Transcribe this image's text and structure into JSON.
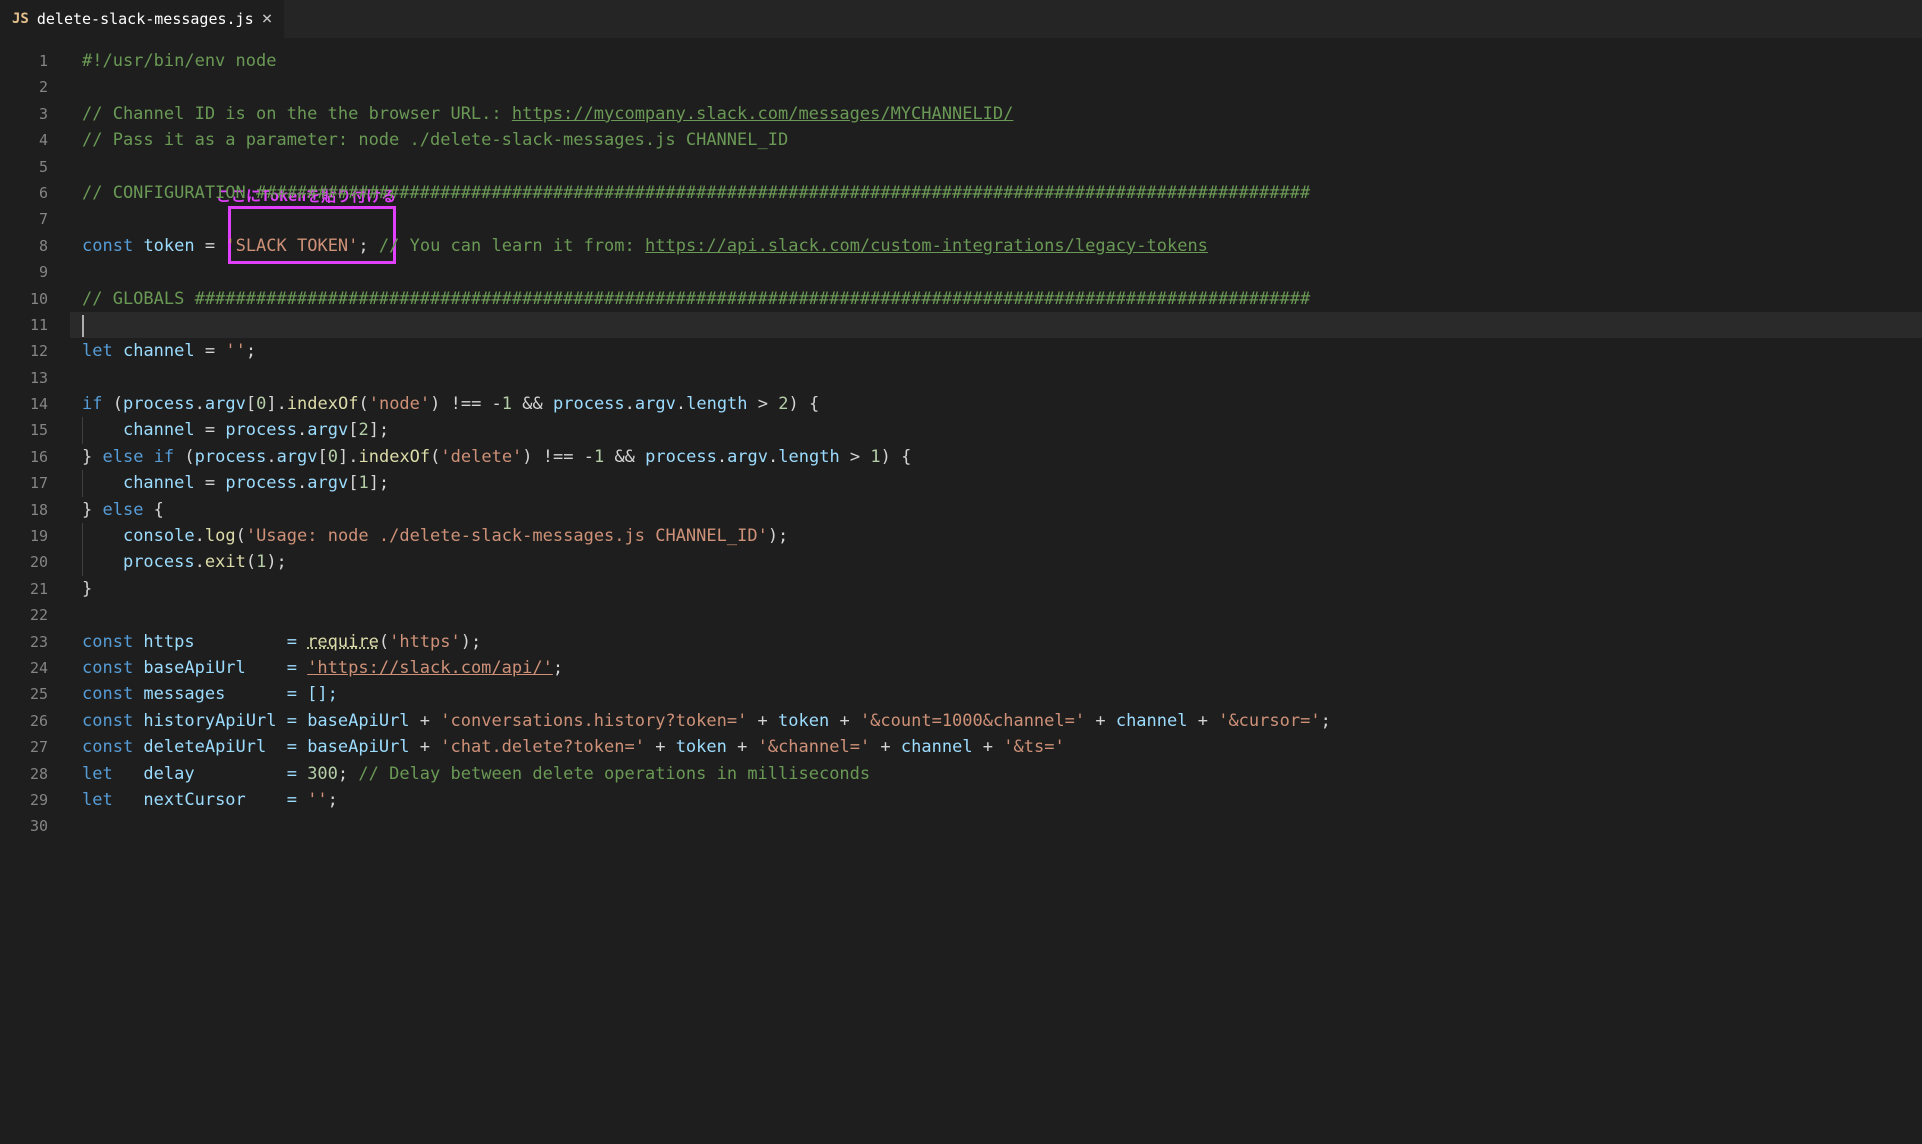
{
  "tab": {
    "icon_text": "JS",
    "title": "delete-slack-messages.js"
  },
  "annotation": {
    "label": "ここにTokenを貼り付ける"
  },
  "lines": [
    {
      "n": 1
    },
    {
      "n": 2
    },
    {
      "n": 3
    },
    {
      "n": 4
    },
    {
      "n": 5
    },
    {
      "n": 6
    },
    {
      "n": 7
    },
    {
      "n": 8
    },
    {
      "n": 9
    },
    {
      "n": 10
    },
    {
      "n": 11
    },
    {
      "n": 12
    },
    {
      "n": 13
    },
    {
      "n": 14
    },
    {
      "n": 15
    },
    {
      "n": 16
    },
    {
      "n": 17
    },
    {
      "n": 18
    },
    {
      "n": 19
    },
    {
      "n": 20
    },
    {
      "n": 21
    },
    {
      "n": 22
    },
    {
      "n": 23
    },
    {
      "n": 24
    },
    {
      "n": 25
    },
    {
      "n": 26
    },
    {
      "n": 27
    },
    {
      "n": 28
    },
    {
      "n": 29
    },
    {
      "n": 30
    }
  ],
  "code": {
    "l1_shebang": "#!/usr/bin/env node",
    "l3_c1": "// Channel ID is on the the browser URL.: ",
    "l3_u": "https://mycompany.slack.com/messages/MYCHANNELID/",
    "l4_c": "// Pass it as a parameter: node ./delete-slack-messages.js CHANNEL_ID",
    "l6_c": "// CONFIGURATION #######################################################################################################",
    "l8_const": "const",
    "l8_token": "token",
    "l8_eq": " = ",
    "l8_str": "'SLACK TOKEN'",
    "l8_semi": ";",
    "l8_c1": " // You can learn it from: ",
    "l8_u": "https://api.slack.com/custom-integrations/legacy-tokens",
    "l10_c": "// GLOBALS #############################################################################################################",
    "l12_let": "let",
    "l12_var": "channel",
    "l12_rest": " = ",
    "l12_str": "''",
    "l12_semi": ";",
    "l14_if": "if",
    "l14_open": " (",
    "l14_proc": "process",
    "l14_dot1": ".",
    "l14_argv": "argv",
    "l14_idx": "[",
    "l14_zero": "0",
    "l14_idx2": "].",
    "l14_indexof": "indexOf",
    "l14_paren": "(",
    "l14_node": "'node'",
    "l14_close1": ") !== -",
    "l14_neg1": "1",
    "l14_and": " && ",
    "l14_proc2": "process",
    "l14_dot2": ".",
    "l14_argv2": "argv",
    "l14_dot3": ".",
    "l14_len": "length",
    "l14_gt": " > ",
    "l14_two": "2",
    "l14_endp": ") {",
    "l15_ind": "    ",
    "l15_chan": "channel",
    "l15_eq": " = ",
    "l15_proc": "process",
    "l15_dot": ".",
    "l15_argv": "argv",
    "l15_br": "[",
    "l15_2": "2",
    "l15_end": "];",
    "l16_cb": "} ",
    "l16_else": "else",
    "l16_sp": " ",
    "l16_if": "if",
    "l16_open": " (",
    "l16_proc": "process",
    "l16_d1": ".",
    "l16_argv": "argv",
    "l16_br": "[",
    "l16_0": "0",
    "l16_br2": "].",
    "l16_io": "indexOf",
    "l16_p": "(",
    "l16_del": "'delete'",
    "l16_cp": ") !== -",
    "l16_1": "1",
    "l16_and": " && ",
    "l16_proc2": "process",
    "l16_d2": ".",
    "l16_argv2": "argv",
    "l16_d3": ".",
    "l16_len": "length",
    "l16_gt": " > ",
    "l16_one": "1",
    "l16_end": ") {",
    "l17_ind": "    ",
    "l17_chan": "channel",
    "l17_eq": " = ",
    "l17_proc": "process",
    "l17_d": ".",
    "l17_argv": "argv",
    "l17_br": "[",
    "l17_1": "1",
    "l17_end": "];",
    "l18_cb": "} ",
    "l18_else": "else",
    "l18_ob": " {",
    "l19_ind": "    ",
    "l19_cons": "console",
    "l19_d": ".",
    "l19_log": "log",
    "l19_p": "(",
    "l19_str": "'Usage: node ./delete-slack-messages.js CHANNEL_ID'",
    "l19_end": ");",
    "l20_ind": "    ",
    "l20_proc": "process",
    "l20_d": ".",
    "l20_exit": "exit",
    "l20_p": "(",
    "l20_1": "1",
    "l20_end": ");",
    "l21_cb": "}",
    "l23_const": "const",
    "l23_https": " https         = ",
    "l23_req": "require",
    "l23_p": "(",
    "l23_str": "'https'",
    "l23_end": ");",
    "l24_const": "const",
    "l24_var": " baseApiUrl    = ",
    "l24_str": "'https://slack.com/api/'",
    "l24_end": ";",
    "l25_const": "const",
    "l25_var": " messages      = [];",
    "l26_const": "const",
    "l26_var": " historyApiUrl = ",
    "l26_base": "baseApiUrl",
    "l26_plus1": " + ",
    "l26_s1": "'conversations.history?token='",
    "l26_plus2": " + ",
    "l26_tok": "token",
    "l26_plus3": " + ",
    "l26_s2": "'&count=1000&channel='",
    "l26_plus4": " + ",
    "l26_ch": "channel",
    "l26_plus5": " + ",
    "l26_s3": "'&cursor='",
    "l26_end": ";",
    "l27_const": "const",
    "l27_var": " deleteApiUrl  = ",
    "l27_base": "baseApiUrl",
    "l27_plus1": " + ",
    "l27_s1": "'chat.delete?token='",
    "l27_plus2": " + ",
    "l27_tok": "token",
    "l27_plus3": " + ",
    "l27_s2": "'&channel='",
    "l27_plus4": " + ",
    "l27_ch": "channel",
    "l27_plus5": " + ",
    "l27_s3": "'&ts='",
    "l28_let": "let",
    "l28_var": "   delay         = ",
    "l28_300": "300",
    "l28_semi": ";",
    "l28_c": " // Delay between delete operations in milliseconds",
    "l29_let": "let",
    "l29_var": "   nextCursor    = ",
    "l29_str": "''",
    "l29_end": ";"
  }
}
